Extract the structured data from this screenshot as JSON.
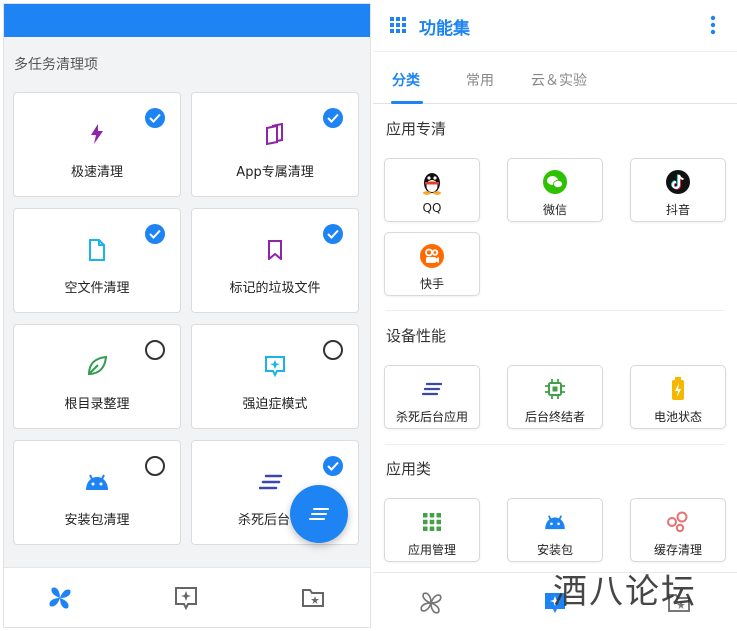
{
  "left": {
    "section_title": "多任务清理项",
    "cards": [
      {
        "label": "极速清理",
        "icon": "bolt-icon",
        "checked": true
      },
      {
        "label": "App专属清理",
        "icon": "app-books-icon",
        "checked": true
      },
      {
        "label": "空文件清理",
        "icon": "document-icon",
        "checked": true
      },
      {
        "label": "标记的垃圾文件",
        "icon": "bookmark-icon",
        "checked": true
      },
      {
        "label": "根目录整理",
        "icon": "leaf-icon",
        "checked": false
      },
      {
        "label": "强迫症模式",
        "icon": "sparkle-box-icon",
        "checked": false
      },
      {
        "label": "安装包清理",
        "icon": "android-icon",
        "checked": false
      },
      {
        "label": "杀死后台",
        "icon": "speed-lines-icon",
        "checked": true
      }
    ]
  },
  "right": {
    "title": "功能集",
    "tabs": [
      {
        "label": "分类",
        "active": true
      },
      {
        "label": "常用",
        "active": false
      },
      {
        "label": "云＆实验",
        "active": false
      }
    ],
    "groups": [
      {
        "title": "应用专清",
        "items": [
          {
            "label": "QQ",
            "icon": "qq-penguin-icon"
          },
          {
            "label": "微信",
            "icon": "wechat-icon"
          },
          {
            "label": "抖音",
            "icon": "tiktok-icon"
          },
          {
            "label": "快手",
            "icon": "kuaishou-icon"
          }
        ]
      },
      {
        "title": "设备性能",
        "items": [
          {
            "label": "杀死后台应用",
            "icon": "speed-lines-icon"
          },
          {
            "label": "后台终结者",
            "icon": "chip-icon"
          },
          {
            "label": "电池状态",
            "icon": "battery-icon"
          }
        ]
      },
      {
        "title": "应用类",
        "items": [
          {
            "label": "应用管理",
            "icon": "grid-apps-icon"
          },
          {
            "label": "安装包",
            "icon": "android-icon"
          },
          {
            "label": "缓存清理",
            "icon": "bubbles-icon"
          }
        ]
      }
    ]
  },
  "watermark": "酒八论坛",
  "colors": {
    "accent": "#1e84f4",
    "purple": "#8e24aa",
    "cyan": "#1ab4e8",
    "green": "#2e9e4f"
  }
}
